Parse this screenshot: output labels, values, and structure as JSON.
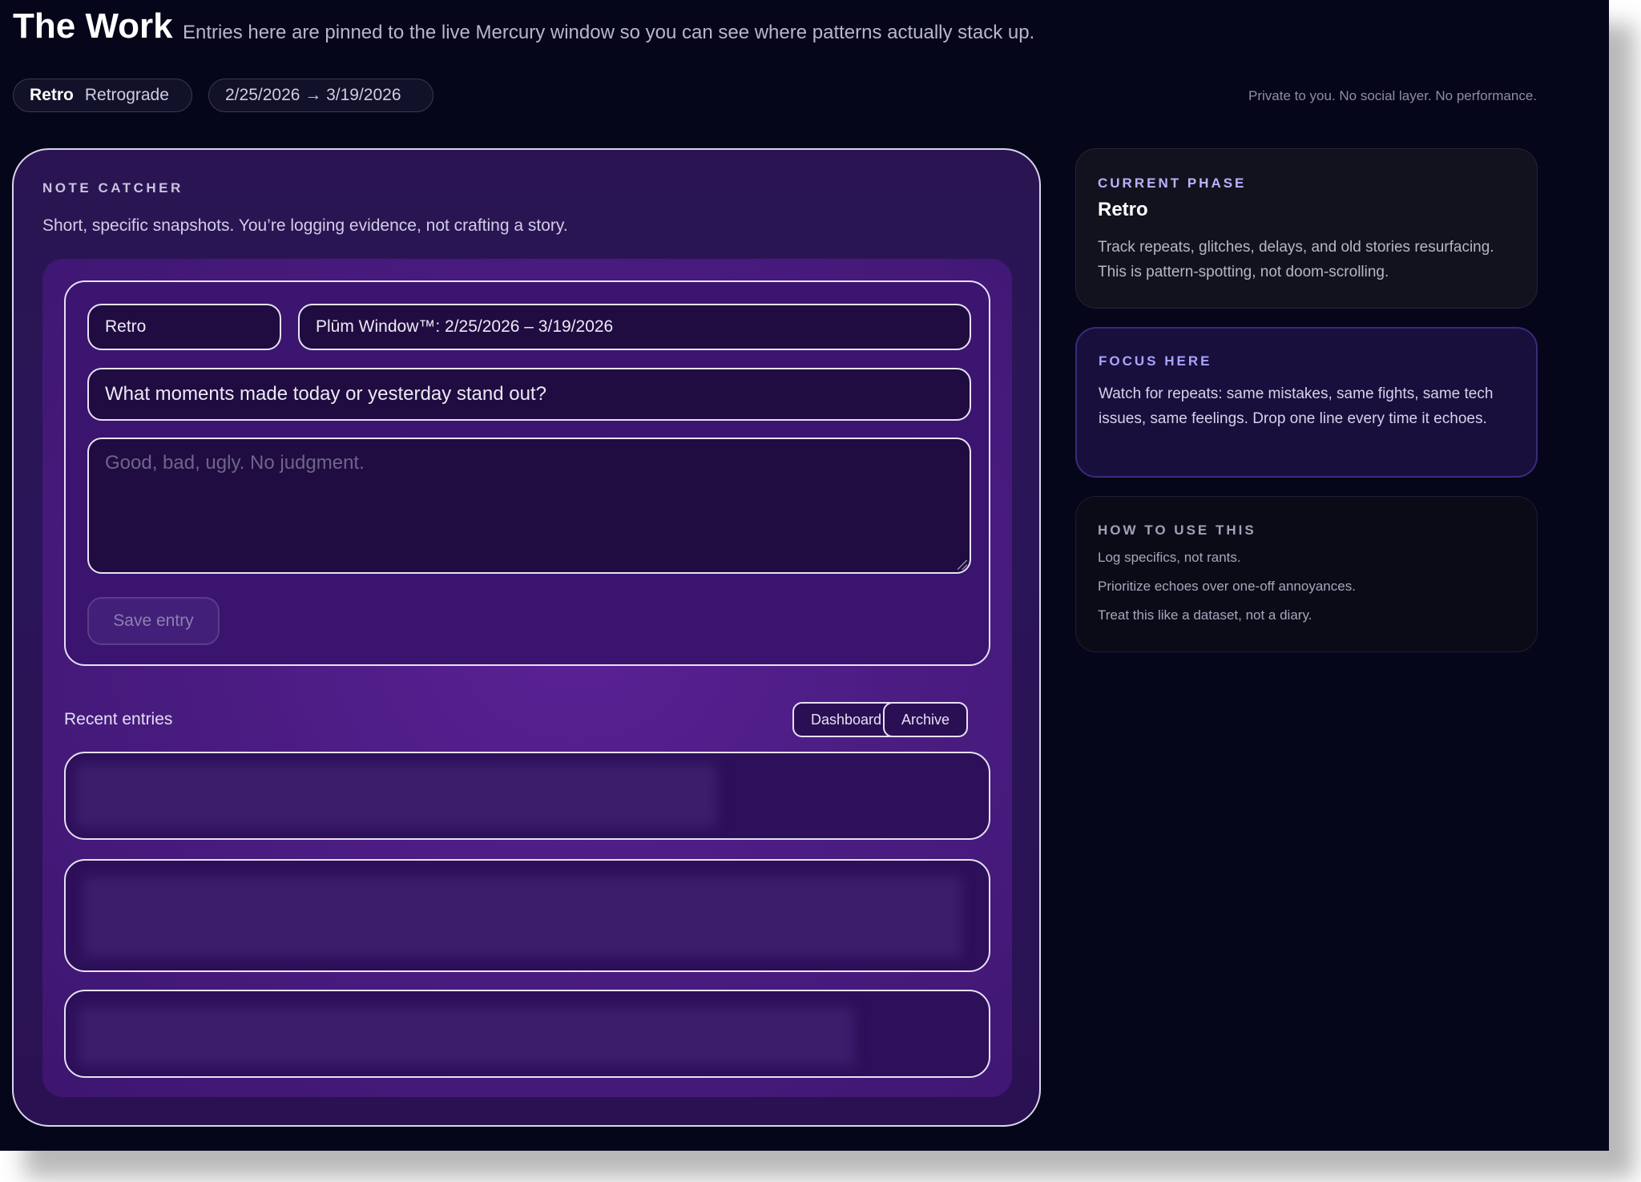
{
  "header": {
    "title": "The Work",
    "subtitle": "Entries here are pinned to the live Mercury window so you can see where patterns actually stack up.",
    "phase_pill": {
      "short": "Retro",
      "long": "Retrograde"
    },
    "range_pill": "2/25/2026 → 3/19/2026",
    "privacy_note": "Private to you. No social layer. No performance."
  },
  "note_catcher": {
    "label": "NOTE CATCHER",
    "description": "Short, specific snapshots. You’re logging evidence, not crafting a story.",
    "form": {
      "phase_value": "Retro",
      "window_value": "Plūm Window™: 2/25/2026 – 3/19/2026",
      "prompt_value": "What moments made today or yesterday stand out?",
      "entry_placeholder": "Good, bad, ugly. No judgment.",
      "save_label": "Save entry"
    },
    "recent": {
      "label": "Recent entries",
      "dashboard_label": "Dashboard",
      "archive_label": "Archive"
    }
  },
  "sidebar": {
    "phase_card": {
      "label": "CURRENT PHASE",
      "name": "Retro",
      "description": "Track repeats, glitches, delays, and old stories resurfacing. This is pattern-spotting, not doom-scrolling."
    },
    "focus_card": {
      "label": "FOCUS HERE",
      "description": "Watch for repeats: same mistakes, same fights, same tech issues, same feelings. Drop one line every time it echoes."
    },
    "howto_card": {
      "label": "HOW TO USE THIS",
      "items": [
        "Log specifics, not rants.",
        "Prioritize echoes over one-off annoyances.",
        "Treat this like a dataset, not a diary."
      ]
    }
  }
}
